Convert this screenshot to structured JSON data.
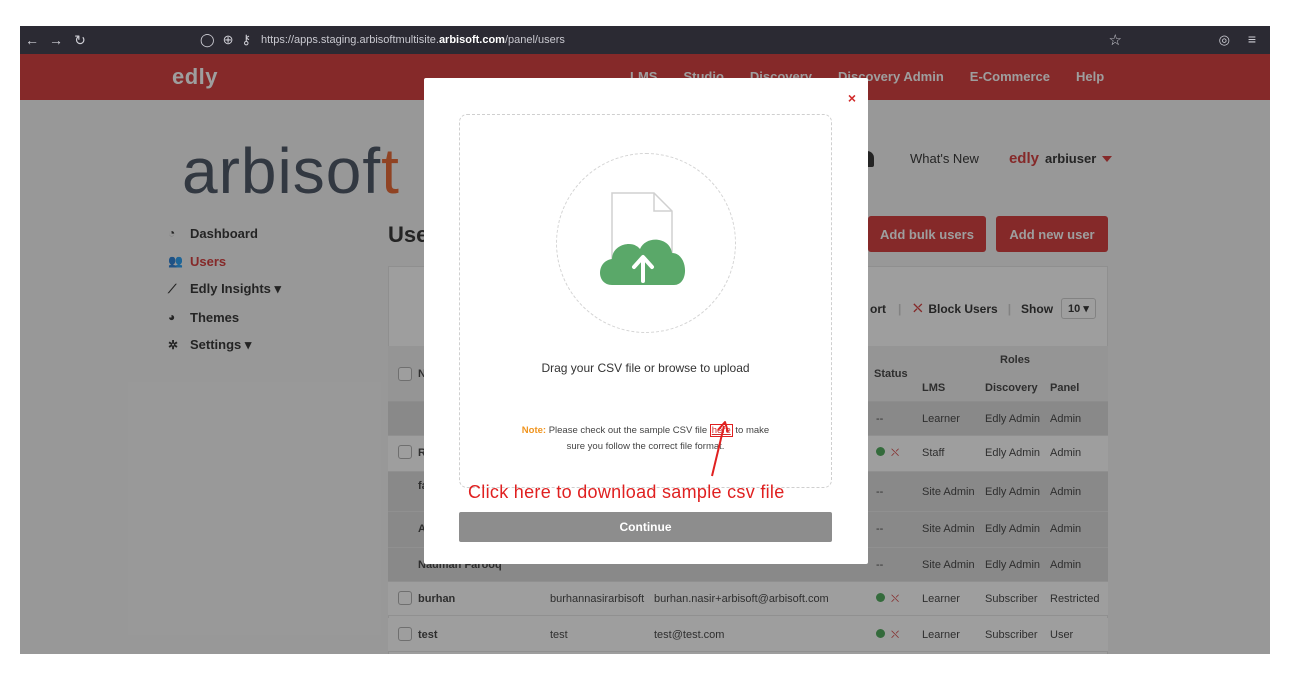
{
  "browser": {
    "url_prefix": "https://apps.staging.arbisoftmultisite.",
    "url_domain": "arbisoft.com",
    "url_path": "/panel/users"
  },
  "nav": {
    "brand": "edly",
    "links": [
      "LMS",
      "Studio",
      "Discovery",
      "Discovery Admin",
      "E-Commerce",
      "Help"
    ]
  },
  "header": {
    "logo_main": "arbisof",
    "logo_accent": "t",
    "whats_new": "What's New",
    "edly_small": "edly",
    "user": "arbiuser"
  },
  "sidebar": {
    "items": [
      {
        "label": "Dashboard",
        "icon": "dashboard-icon"
      },
      {
        "label": "Users",
        "icon": "users-icon"
      },
      {
        "label": "Edly Insights ▾",
        "icon": "insights-icon"
      },
      {
        "label": "Themes",
        "icon": "palette-icon"
      },
      {
        "label": "Settings ▾",
        "icon": "gear-icon"
      }
    ]
  },
  "page": {
    "title": "Use",
    "add_bulk": "Add bulk users",
    "add_new": "Add new user",
    "export_label": "ort",
    "block_users": "Block Users",
    "show_label": "Show",
    "show_value": "10 ▾"
  },
  "table": {
    "headers": {
      "name": "N",
      "status": "Status",
      "roles": "Roles",
      "lms": "LMS",
      "discovery": "Discovery",
      "panel": "Panel"
    },
    "rows": [
      {
        "name": "",
        "username": "",
        "email": "",
        "status": "--",
        "lms": "Learner",
        "discovery": "Edly Admin",
        "panel": "Admin",
        "dark": true
      },
      {
        "name": "R",
        "username": "",
        "email": "",
        "status": "ok",
        "lms": "Staff",
        "discovery": "Edly Admin",
        "panel": "Admin",
        "dark": false
      },
      {
        "name": "fa",
        "username": "",
        "email": "",
        "status": "--",
        "lms": "Site Admin",
        "discovery": "Edly Admin",
        "panel": "Admin",
        "dark": true
      },
      {
        "name": "A",
        "username": "",
        "email": "",
        "status": "--",
        "lms": "Site Admin",
        "discovery": "Edly Admin",
        "panel": "Admin",
        "dark": true
      },
      {
        "name": "Nauman Farooq",
        "username": "",
        "email": "",
        "status": "--",
        "lms": "Site Admin",
        "discovery": "Edly Admin",
        "panel": "Admin",
        "dark": true
      },
      {
        "name": "burhan",
        "username": "burhannasirarbisoft",
        "email": "burhan.nasir+arbisoft@arbisoft.com",
        "status": "ok",
        "lms": "Learner",
        "discovery": "Subscriber",
        "panel": "Restricted",
        "dark": false
      },
      {
        "name": "test",
        "username": "test",
        "email": "test@test.com",
        "status": "ok",
        "lms": "Learner",
        "discovery": "Subscriber",
        "panel": "User",
        "dark": false
      }
    ]
  },
  "modal": {
    "close": "×",
    "drag_text": "Drag your CSV file or browse to upload",
    "note_label": "Note:",
    "note_before": " Please check out the sample CSV file ",
    "here": "here",
    "note_after": " to make",
    "note_line2": "sure you follow the correct file format.",
    "annotation": "Click here to download sample csv file",
    "continue": "Continue"
  },
  "colors": {
    "brand_red": "#d12a2a",
    "cloud_green": "#5aa869",
    "note_orange": "#f0941e",
    "annotation_red": "#e02020"
  }
}
